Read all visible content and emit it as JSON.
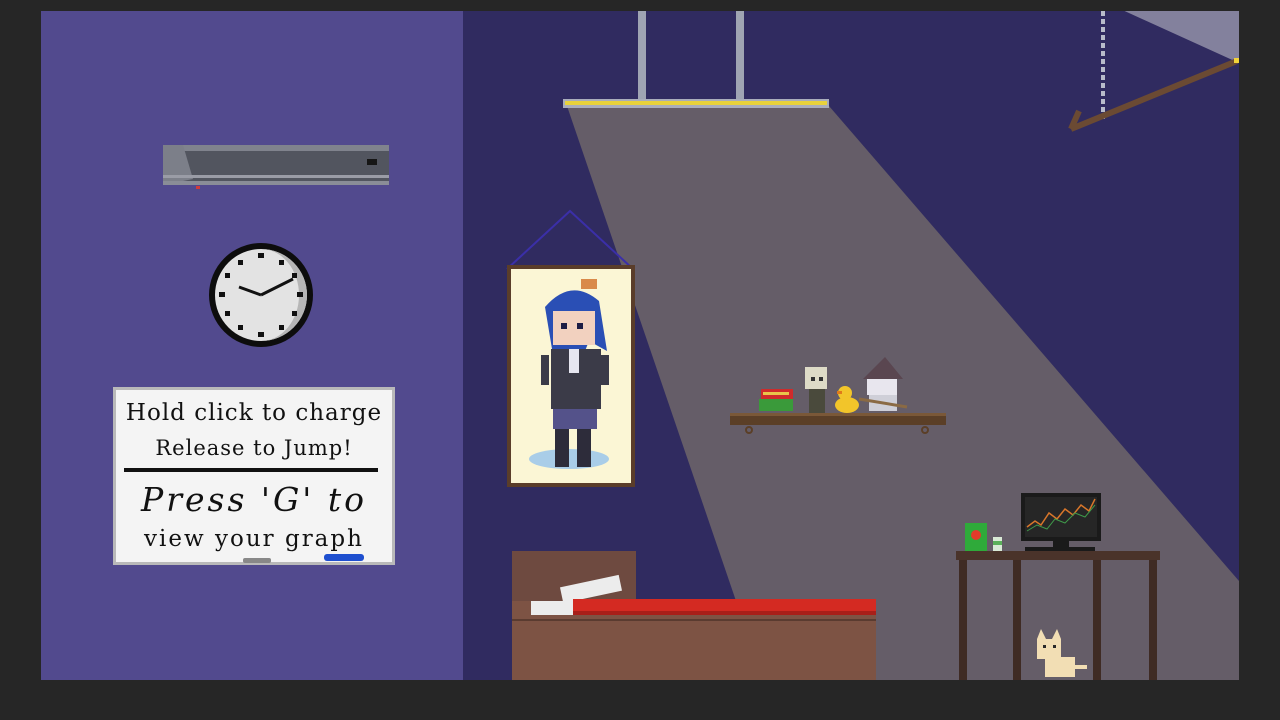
{
  "whiteboard": {
    "line1": "Hold click to charge",
    "line2": "Release to Jump!",
    "line3": "Press 'G' to",
    "line4": "view your graph"
  },
  "colors": {
    "frame": "#262626",
    "wall_left": "#524a8e",
    "wall_right": "#302b60",
    "light_cone": "#d8c77a",
    "bed_sheet": "#d42a22",
    "shelf": "#5b3f27"
  },
  "icons": [
    "air-conditioner-icon",
    "clock-icon",
    "poster-icon",
    "ceiling-lamp-icon",
    "spotlight-icon",
    "shelf-icon",
    "book-stack-icon",
    "figurine-icon",
    "rubber-duck-icon",
    "witch-figurine-icon",
    "bed-icon",
    "desk-icon",
    "monitor-icon",
    "chips-bag-icon",
    "drink-can-icon",
    "cat-icon"
  ],
  "monitor": {
    "chart": "rising-line-graph"
  }
}
